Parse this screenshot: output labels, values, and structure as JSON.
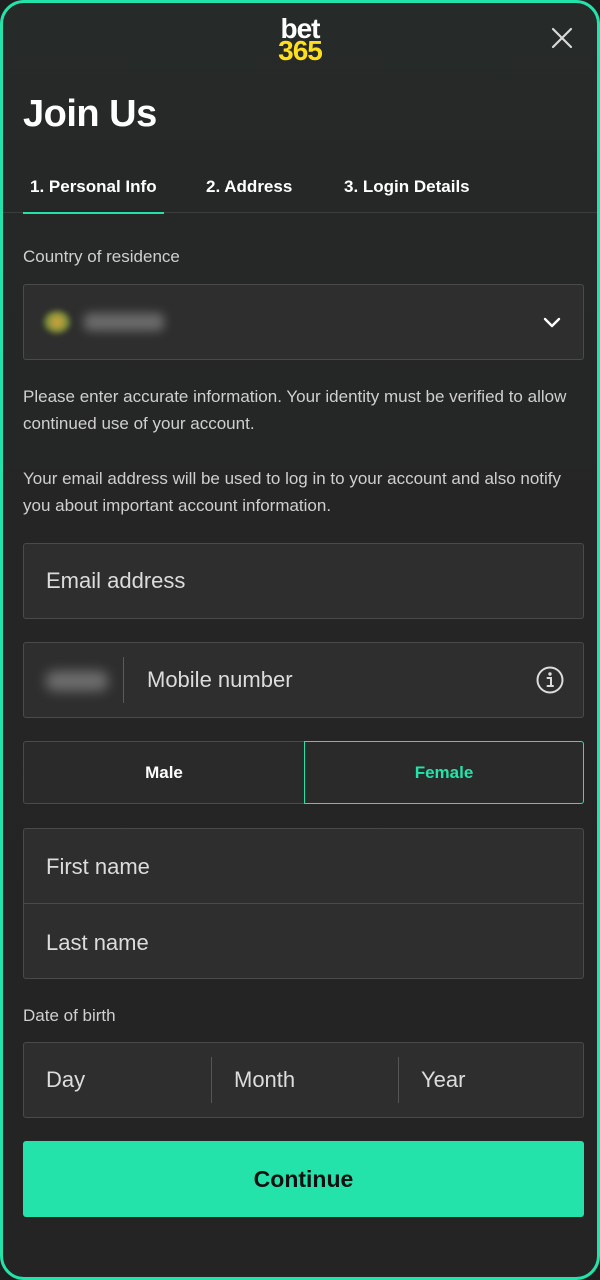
{
  "brand": {
    "logo_top": "bet",
    "logo_bottom": "365",
    "accent_color": "#23e3aa",
    "logo_accent": "#ffdf1b"
  },
  "header": {
    "title": "Join Us",
    "close_icon": "close-icon"
  },
  "tabs": [
    {
      "label": "1.  Personal Info",
      "active": true
    },
    {
      "label": "2.  Address",
      "active": false
    },
    {
      "label": "3.  Login Details",
      "active": false
    }
  ],
  "country": {
    "label": "Country of residence",
    "chevron_icon": "chevron-down-icon"
  },
  "info": {
    "paragraph1": "Please enter accurate information. Your identity must be verified to allow continued use of your account.",
    "paragraph2": "Your email address will be used to log in to your account and also notify you about important account information."
  },
  "form": {
    "email_placeholder": "Email address",
    "mobile_placeholder": "Mobile number",
    "mobile_info_icon": "info-icon",
    "gender": {
      "male": "Male",
      "female": "Female",
      "selected": "Female"
    },
    "first_name_placeholder": "First name",
    "last_name_placeholder": "Last name",
    "dob": {
      "label": "Date of birth",
      "day": "Day",
      "month": "Month",
      "year": "Year"
    }
  },
  "actions": {
    "continue": "Continue"
  }
}
